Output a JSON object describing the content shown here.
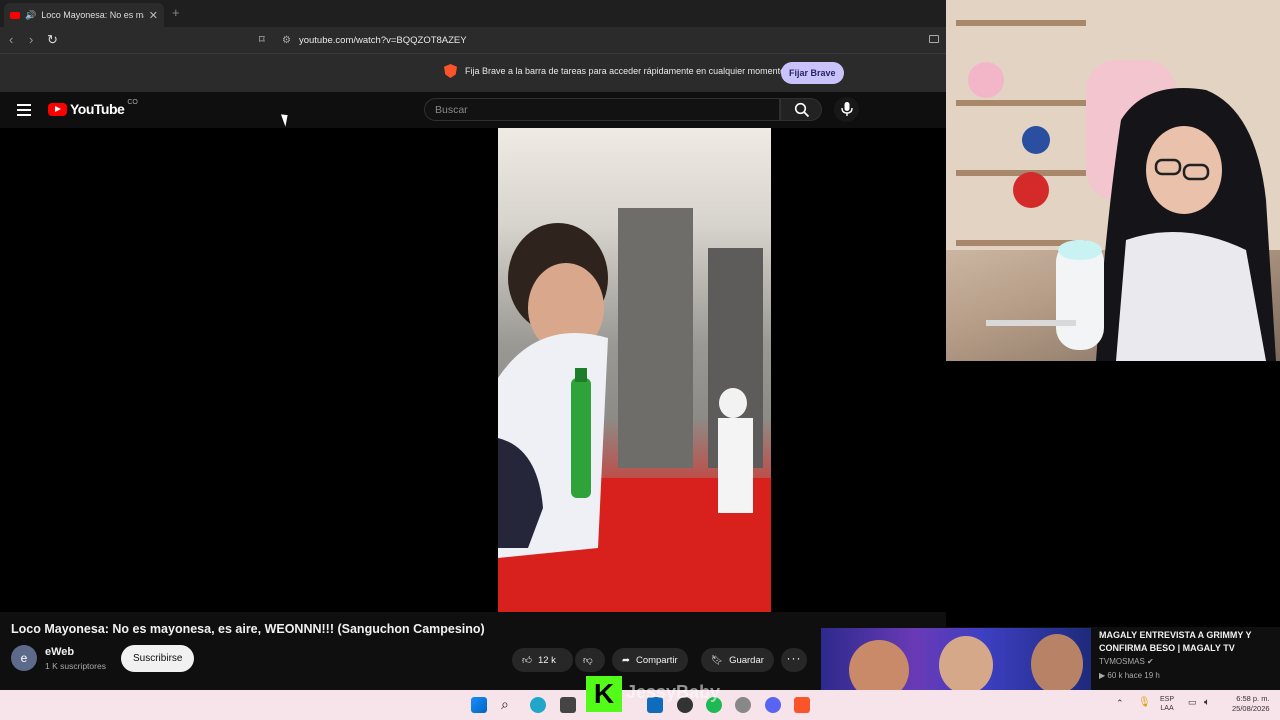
{
  "browser": {
    "tab_title": "Loco Mayonesa: No es mayonesa, es aire, WEONNN!!! (Sanguchon Campesino)",
    "close_glyph": "✕",
    "new_tab_glyph": "+",
    "url": "youtube.com/watch?v=BQQZOT8AZEY",
    "infobar_message": "Fija Brave a la barra de tareas para acceder rápidamente en cualquier momento",
    "infobar_button": "Fijar Brave"
  },
  "youtube": {
    "logo_text": "YouTube",
    "country_code": "CO",
    "search_placeholder": "Buscar"
  },
  "video": {
    "title": "Loco Mayonesa: No es mayonesa, es aire, WEONNN!!! (Sanguchon Campesino)",
    "channel_initial": "e",
    "channel_name": "eWeb",
    "subscribers": "1 K suscriptores",
    "subscribe_label": "Suscribirse",
    "likes": "12 k",
    "share_label": "Compartir",
    "save_label": "Guardar",
    "more_glyph": "···"
  },
  "suggestion": {
    "title": "MAGALY ENTREVISTA A GRIMMY Y CONFIRMA BESO  | MAGALY TV",
    "channel": "TVMOSMAS",
    "meta": "60 k  hace 19 h"
  },
  "overlay": {
    "kick_letter": "K",
    "streamer_name": "JessyBaby"
  },
  "taskbar": {
    "lang_line1": "ESP",
    "lang_line2": "LAA",
    "time": "6:58 p. m.",
    "date": "25/08/2026"
  },
  "colors": {
    "youtube_red": "#ff0000",
    "brave_orange": "#fb542b",
    "kick_green": "#53fc18",
    "taskbar_bg": "#f7e3ea"
  }
}
